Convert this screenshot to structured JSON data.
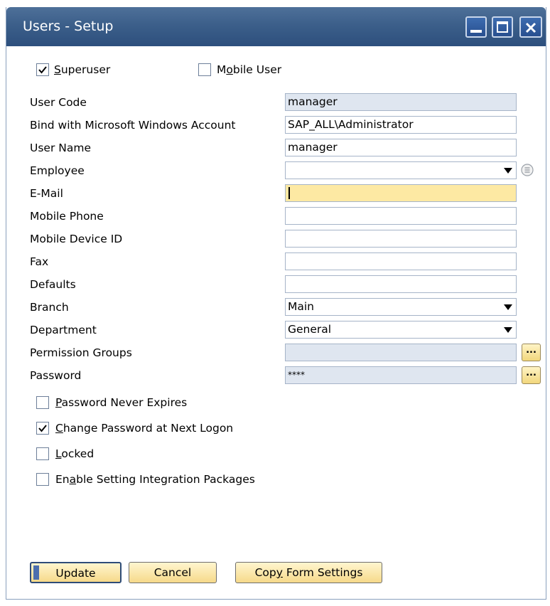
{
  "window": {
    "title": "Users - Setup",
    "colors": {
      "title_bar": "#3c5f8a",
      "focus_field": "#fde9a3",
      "readonly_field": "#dfe6f0",
      "button": "#f6d98a"
    }
  },
  "top_checks": {
    "superuser": {
      "pre": "",
      "hot": "S",
      "post": "uperuser",
      "checked": true
    },
    "mobile_user": {
      "pre": "M",
      "hot": "o",
      "post": "bile User",
      "checked": false
    }
  },
  "fields": {
    "user_code": {
      "label": "User Code",
      "value": "manager"
    },
    "bind_windows": {
      "label": "Bind with Microsoft Windows Account",
      "value": "SAP_ALL\\Administrator"
    },
    "user_name": {
      "label": "User Name",
      "value": "manager"
    },
    "employee": {
      "label": "Employee",
      "value": ""
    },
    "email": {
      "label": "E-Mail",
      "value": ""
    },
    "mobile_phone": {
      "label": "Mobile Phone",
      "value": ""
    },
    "mobile_device_id": {
      "label": "Mobile Device ID",
      "value": ""
    },
    "fax": {
      "label": "Fax",
      "value": ""
    },
    "defaults": {
      "label": "Defaults",
      "value": ""
    },
    "branch": {
      "label": "Branch",
      "value": "Main"
    },
    "department": {
      "label": "Department",
      "value": "General"
    },
    "permission_groups": {
      "label": "Permission Groups",
      "value": ""
    },
    "password": {
      "label": "Password",
      "value": "****"
    }
  },
  "options": {
    "never_expires": {
      "pre": "",
      "hot": "P",
      "post": "assword Never Expires",
      "checked": false
    },
    "change_password": {
      "pre": "",
      "hot": "C",
      "post": "hange Password at Next Logon",
      "checked": true
    },
    "locked": {
      "pre": "",
      "hot": "L",
      "post": "ocked",
      "checked": false
    },
    "integration": {
      "pre": "En",
      "hot": "a",
      "post": "ble Setting Integration Packages",
      "checked": false
    }
  },
  "buttons": {
    "update": "Update",
    "cancel": "Cancel",
    "copy_pre": "Cop",
    "copy_hot": "y",
    "copy_post": " Form Settings",
    "ellipsis": "..."
  },
  "icons": {
    "minimize": "minimize-icon",
    "maximize": "maximize-icon",
    "close": "close-icon",
    "list": "list-icon",
    "check": "check-icon",
    "dropdown": "chevron-down-icon"
  }
}
